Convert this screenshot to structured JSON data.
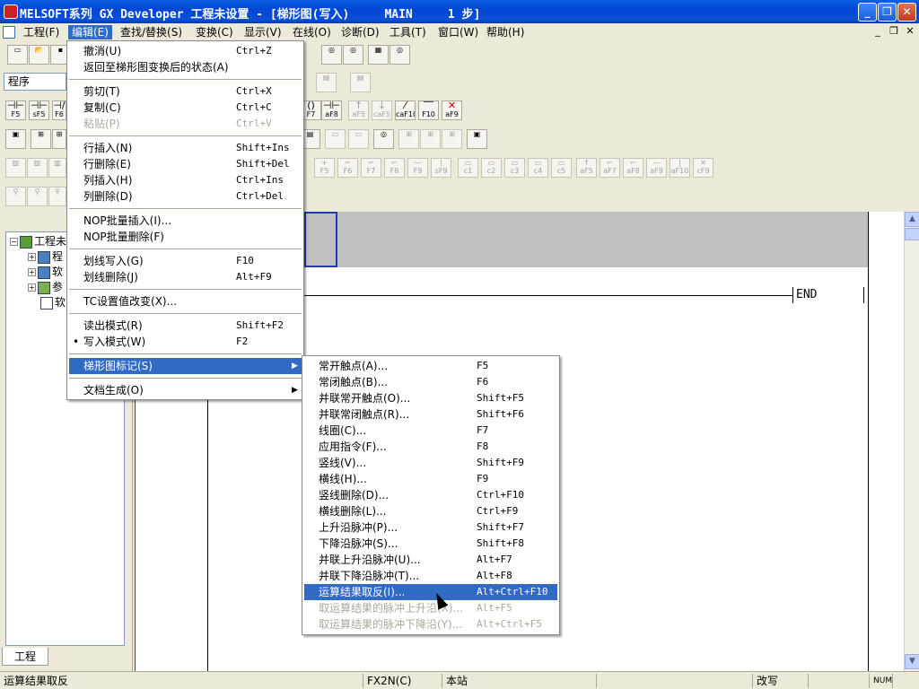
{
  "window": {
    "title": "MELSOFT系列 GX Developer 工程未设置 - [梯形图(写入)     MAIN     1 步]",
    "minimize": "_",
    "restore": "❐",
    "close": "✕"
  },
  "menubar": {
    "items": [
      "工程(F)",
      "编辑(E)",
      "查找/替换(S)",
      "变换(C)",
      "显示(V)",
      "在线(O)",
      "诊断(D)",
      "工具(T)",
      "窗口(W)",
      "帮助(H)"
    ],
    "mdi": [
      "_",
      "❐",
      "✕"
    ]
  },
  "toolbar": {
    "combo_value": "程序",
    "row3": [
      "F5",
      "sF5",
      "F6",
      "F7",
      "aF8",
      "aF5",
      "caF5",
      "caF10",
      "F10",
      "aF9"
    ],
    "row5": [
      "F5",
      "F6",
      "F7",
      "F8",
      "F9",
      "sF9",
      "c1",
      "c2",
      "c3",
      "c4",
      "c5",
      "aF5",
      "aF7",
      "aF8",
      "aF9",
      "aF10",
      "cF9"
    ]
  },
  "project": {
    "tree_root": "工程未",
    "tree_items": [
      "程",
      "软",
      "参",
      "软"
    ],
    "tab": "工程"
  },
  "ladder": {
    "end_label": "END"
  },
  "edit_menu": {
    "undo": {
      "label": "撤消(U)",
      "shortcut": "Ctrl+Z"
    },
    "revert": {
      "label": "返回至梯形图变换后的状态(A)"
    },
    "cut": {
      "label": "剪切(T)",
      "shortcut": "Ctrl+X"
    },
    "copy": {
      "label": "复制(C)",
      "shortcut": "Ctrl+C"
    },
    "paste": {
      "label": "粘贴(P)",
      "shortcut": "Ctrl+V"
    },
    "insert_row": {
      "label": "行插入(N)",
      "shortcut": "Shift+Ins"
    },
    "delete_row": {
      "label": "行删除(E)",
      "shortcut": "Shift+Del"
    },
    "insert_col": {
      "label": "列插入(H)",
      "shortcut": "Ctrl+Ins"
    },
    "delete_col": {
      "label": "列删除(D)",
      "shortcut": "Ctrl+Del"
    },
    "nop_insert": {
      "label": "NOP批量插入(I)..."
    },
    "nop_delete": {
      "label": "NOP批量删除(F)"
    },
    "line_write": {
      "label": "划线写入(G)",
      "shortcut": "F10"
    },
    "line_delete": {
      "label": "划线删除(J)",
      "shortcut": "Alt+F9"
    },
    "tc_change": {
      "label": "TC设置值改变(X)..."
    },
    "read_mode": {
      "label": "读出模式(R)",
      "shortcut": "Shift+F2"
    },
    "write_mode": {
      "label": "写入模式(W)",
      "shortcut": "F2"
    },
    "ladder_symbol": {
      "label": "梯形图标记(S)"
    },
    "doc_gen": {
      "label": "文档生成(O)"
    }
  },
  "symbol_menu": {
    "items": [
      {
        "label": "常开触点(A)...",
        "shortcut": "F5"
      },
      {
        "label": "常闭触点(B)...",
        "shortcut": "F6"
      },
      {
        "label": "并联常开触点(O)...",
        "shortcut": "Shift+F5"
      },
      {
        "label": "并联常闭触点(R)...",
        "shortcut": "Shift+F6"
      },
      {
        "label": "线圈(C)...",
        "shortcut": "F7"
      },
      {
        "label": "应用指令(F)...",
        "shortcut": "F8"
      },
      {
        "label": "竖线(V)...",
        "shortcut": "Shift+F9"
      },
      {
        "label": "横线(H)...",
        "shortcut": "F9"
      },
      {
        "label": "竖线删除(D)...",
        "shortcut": "Ctrl+F10"
      },
      {
        "label": "横线删除(L)...",
        "shortcut": "Ctrl+F9"
      },
      {
        "label": "上升沿脉冲(P)...",
        "shortcut": "Shift+F7"
      },
      {
        "label": "下降沿脉冲(S)...",
        "shortcut": "Shift+F8"
      },
      {
        "label": "并联上升沿脉冲(U)...",
        "shortcut": "Alt+F7"
      },
      {
        "label": "并联下降沿脉冲(T)...",
        "shortcut": "Alt+F8"
      },
      {
        "label": "运算结果取反(I)...",
        "shortcut": "Alt+Ctrl+F10"
      },
      {
        "label": "取运算结果的脉冲上升沿(X)...",
        "shortcut": "Alt+F5"
      },
      {
        "label": "取运算结果的脉冲下降沿(Y)...",
        "shortcut": "Alt+Ctrl+F5"
      }
    ]
  },
  "statusbar": {
    "message": "运算结果取反",
    "cpu": "FX2N(C)",
    "station": "本站",
    "mode": "改写",
    "num": "NUM"
  }
}
